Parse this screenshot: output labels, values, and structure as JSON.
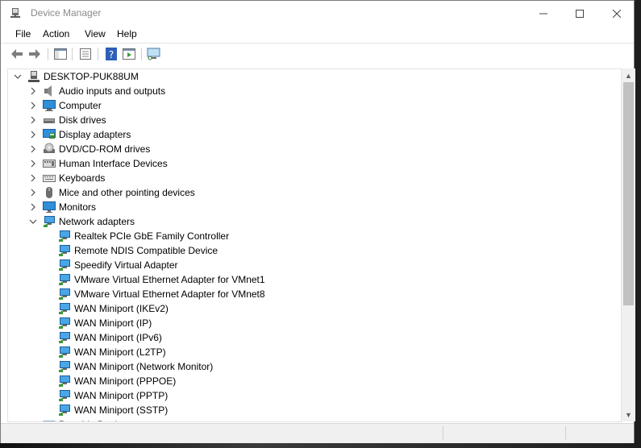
{
  "window": {
    "title": "Device Manager",
    "controls": {
      "minimize": "—",
      "maximize": "☐",
      "close": "✕"
    }
  },
  "menu": [
    "File",
    "Action",
    "View",
    "Help"
  ],
  "toolbar": [
    "back-arrow",
    "forward-arrow",
    "console-tree",
    "properties",
    "help",
    "run",
    "monitor-scan"
  ],
  "tree": {
    "root": "DESKTOP-PUK88UM",
    "categories": [
      {
        "label": "Audio inputs and outputs",
        "icon": "speaker-icon",
        "expanded": false
      },
      {
        "label": "Computer",
        "icon": "computer-icon",
        "expanded": false
      },
      {
        "label": "Disk drives",
        "icon": "disk-drive-icon",
        "expanded": false
      },
      {
        "label": "Display adapters",
        "icon": "display-adapter-icon",
        "expanded": false
      },
      {
        "label": "DVD/CD-ROM drives",
        "icon": "dvd-icon",
        "expanded": false
      },
      {
        "label": "Human Interface Devices",
        "icon": "hid-icon",
        "expanded": false
      },
      {
        "label": "Keyboards",
        "icon": "keyboard-icon",
        "expanded": false
      },
      {
        "label": "Mice and other pointing devices",
        "icon": "mouse-icon",
        "expanded": false
      },
      {
        "label": "Monitors",
        "icon": "monitor-icon",
        "expanded": false
      },
      {
        "label": "Network adapters",
        "icon": "network-icon",
        "expanded": true,
        "children": [
          "Realtek PCIe GbE Family Controller",
          "Remote NDIS Compatible Device",
          "Speedify Virtual Adapter",
          "VMware Virtual Ethernet Adapter for VMnet1",
          "VMware Virtual Ethernet Adapter for VMnet8",
          "WAN Miniport (IKEv2)",
          "WAN Miniport (IP)",
          "WAN Miniport (IPv6)",
          "WAN Miniport (L2TP)",
          "WAN Miniport (Network Monitor)",
          "WAN Miniport (PPPOE)",
          "WAN Miniport (PPTP)",
          "WAN Miniport (SSTP)"
        ]
      },
      {
        "label": "Portable Devices",
        "icon": "portable-device-icon",
        "expanded": false
      }
    ]
  },
  "colors": {
    "accent": "#1e90ff",
    "network": "#2f8fd8"
  }
}
